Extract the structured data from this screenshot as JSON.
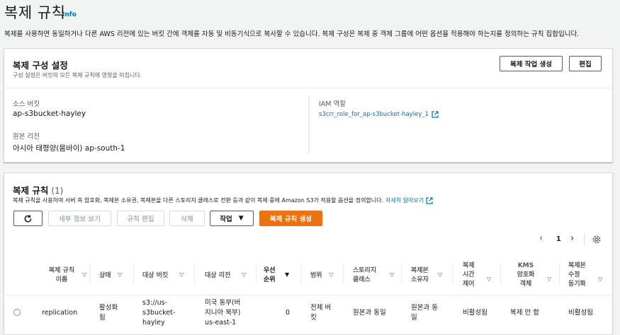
{
  "page": {
    "title": "복제 규칙",
    "info": "Info",
    "description": "복제를 사용하면 동일하거나 다른 AWS 리전에 있는 버킷 간에 객체를 자동 및 비동기식으로 복사할 수 있습니다. 복제 구성은 복제 중 객체 그룹에 어떤 옵션을 적용해야 하는지를 정의하는 규칙 집합입니다."
  },
  "config": {
    "title": "복제 구성 설정",
    "subtitle": "구성 설정은 버킷의 모든 복제 규칙에 영향을 미칩니다.",
    "create_job_button": "복제 작업 생성",
    "edit_button": "편집",
    "source_bucket_label": "소스 버킷",
    "source_bucket_value": "ap-s3bucket-hayley",
    "source_region_label": "원본 리전",
    "source_region_value": "아시아 태평양(뭄바이) ap-south-1",
    "iam_role_label": "IAM 역할",
    "iam_role_value": "s3crr_role_for_ap-s3bucket-hayley_1"
  },
  "rules": {
    "title": "복제 규칙",
    "count": "(1)",
    "description": "복제 규칙을 사용하여 서버 측 암호화, 복제본 소유권, 복제본을 다른 스토리지 클래스로 전환 등과 같이 복제 중에 Amazon S3가 적용할 옵션을 정의합니다.",
    "learn_more": "자세히 알아보기",
    "buttons": {
      "view_details": "세부 정보 보기",
      "edit_rule": "규칙 편집",
      "delete": "삭제",
      "actions": "작업",
      "create_rule": "복제 규칙 생성"
    },
    "pagination": {
      "page": "1"
    },
    "columns": [
      {
        "label": "복제 규칙\n이름",
        "sort": "▽"
      },
      {
        "label": "상태",
        "sort": "▽"
      },
      {
        "label": "대상 버킷",
        "sort": "▽"
      },
      {
        "label": "대상 리전",
        "sort": "▽"
      },
      {
        "label": "우선\n순위",
        "sort": "▼"
      },
      {
        "label": "범위",
        "sort": "▽"
      },
      {
        "label": "스토리지\n클래스",
        "sort": "▽"
      },
      {
        "label": "복제본\n소유자",
        "sort": "▽"
      },
      {
        "label": "복제\n시간\n제어",
        "sort": "▽"
      },
      {
        "label": "KMS\n암호화\n객체",
        "sort": "▽"
      },
      {
        "label": "복제본\n수정\n동기화",
        "sort": "▽"
      }
    ],
    "rows": [
      {
        "name": "replication",
        "status": "활성화\n됨",
        "dest_bucket": "s3://us-\ns3bucket-\nhayley",
        "dest_region": "미국 동부(버\n지니아 북부)\nus-east-1",
        "priority": "0",
        "scope": "전체 버\n킷",
        "storage_class": "원본과 동일",
        "owner": "원본과 동\n일",
        "rtc": "비활성됨",
        "kms": "복제 안 함",
        "sync": "비활성됨"
      }
    ]
  },
  "colors": {
    "link": "#0073bb",
    "primary": "#ec7211",
    "background": "#f2f3f3"
  }
}
